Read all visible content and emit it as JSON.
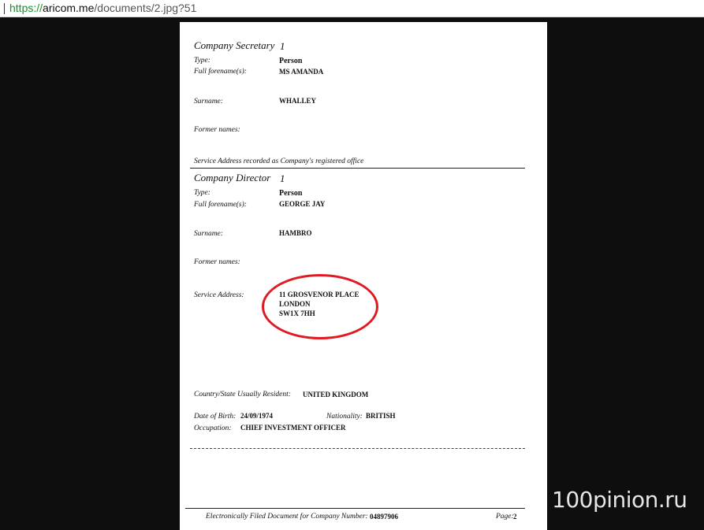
{
  "browser": {
    "url_scheme": "https://",
    "url_host": "aricom.me",
    "url_path": "/documents/2.jpg?51"
  },
  "document": {
    "secretary": {
      "heading": "Company Secretary",
      "number": "1",
      "type_label": "Type:",
      "type_value": "Person",
      "forename_label": "Full forename(s):",
      "forename_value": "MS AMANDA",
      "surname_label": "Surname:",
      "surname_value": "WHALLEY",
      "former_label": "Former names:",
      "service_note": "Service Address recorded as Company's registered office"
    },
    "director": {
      "heading": "Company Director",
      "number": "1",
      "type_label": "Type:",
      "type_value": "Person",
      "forename_label": "Full forename(s):",
      "forename_value": "GEORGE JAY",
      "surname_label": "Surname:",
      "surname_value": "HAMBRO",
      "former_label": "Former names:",
      "address_label": "Service Address:",
      "address_line1": "11 GROSVENOR PLACE",
      "address_line2": "LONDON",
      "address_line3": "SW1X 7HH",
      "country_label": "Country/State Usually Resident:",
      "country_value": "UNITED KINGDOM",
      "dob_label": "Date of Birth:",
      "dob_value": "24/09/1974",
      "nationality_label": "Nationality:",
      "nationality_value": "BRITISH",
      "occupation_label": "Occupation:",
      "occupation_value": "CHIEF INVESTMENT OFFICER"
    },
    "footer": {
      "filed_text": "Electronically Filed Document for Company Number:",
      "company_number": "04897906",
      "page_label": "Page:",
      "page_number": "2"
    }
  },
  "annotation": {
    "highlight_color": "#e01a22"
  },
  "watermark": {
    "text": "100pinion.ru"
  }
}
